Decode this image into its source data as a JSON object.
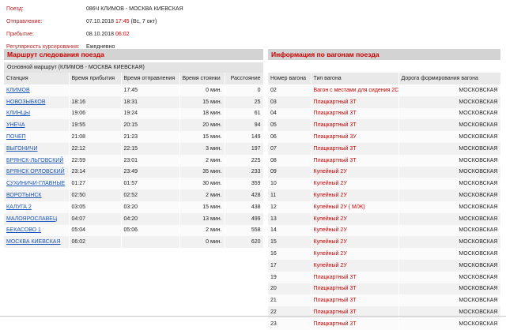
{
  "train": {
    "label": "Поезд:",
    "value": "086Ч КЛИМОВ - МОСКВА КИЕВСКАЯ",
    "dep_label": "Отправление:",
    "dep_date": "07.10.2018",
    "dep_time": "17:45",
    "dep_day": "(Вс, 7 окт)",
    "arr_label": "Прибытие:",
    "arr_date": "08.10.2018",
    "arr_time": "06:02",
    "reg_label": "Регулярность курсирования:",
    "reg_value": "Ежедневно"
  },
  "route": {
    "title": "Маршрут следования поезда",
    "subtitle": "Основной маршрут (КЛИМОВ - МОСКВА КИЕВСКАЯ)",
    "columns": [
      "Станция",
      "Время прибытия",
      "Время отправления",
      "Время стоянки",
      "Расстояние"
    ],
    "rows": [
      {
        "station": "КЛИМОВ",
        "arr": "",
        "dep": "17:45",
        "stop": "0 мин.",
        "dist": "0"
      },
      {
        "station": "НОВОЗЫБКОВ",
        "arr": "18:16",
        "dep": "18:31",
        "stop": "15 мин.",
        "dist": "25"
      },
      {
        "station": "КЛИНЦЫ",
        "arr": "19:06",
        "dep": "19:24",
        "stop": "18 мин.",
        "dist": "61"
      },
      {
        "station": "УНЕЧА",
        "arr": "19:55",
        "dep": "20:15",
        "stop": "20 мин.",
        "dist": "94"
      },
      {
        "station": "ПОЧЕП",
        "arr": "21:08",
        "dep": "21:23",
        "stop": "15 мин.",
        "dist": "149"
      },
      {
        "station": "ВЫГОНИЧИ",
        "arr": "22:12",
        "dep": "22:15",
        "stop": "3 мин.",
        "dist": "197"
      },
      {
        "station": "БРЯНСК-ЛЬГОВСКИЙ",
        "arr": "22:59",
        "dep": "23:01",
        "stop": "2 мин.",
        "dist": "225"
      },
      {
        "station": "БРЯНСК ОРЛОВСКИЙ",
        "arr": "23:14",
        "dep": "23:49",
        "stop": "35 мин.",
        "dist": "233"
      },
      {
        "station": "СУХИНИЧИ-ГЛАВНЫЕ",
        "arr": "01:27",
        "dep": "01:57",
        "stop": "30 мин.",
        "dist": "359"
      },
      {
        "station": "ВОРОТЫНСК",
        "arr": "02:50",
        "dep": "02:52",
        "stop": "2 мин.",
        "dist": "428"
      },
      {
        "station": "КАЛУГА 2",
        "arr": "03:05",
        "dep": "03:20",
        "stop": "15 мин.",
        "dist": "438"
      },
      {
        "station": "МАЛОЯРОСЛАВЕЦ",
        "arr": "04:07",
        "dep": "04:20",
        "stop": "13 мин.",
        "dist": "499"
      },
      {
        "station": "БЕКАСОВО 1",
        "arr": "05:04",
        "dep": "05:06",
        "stop": "2 мин.",
        "dist": "558"
      },
      {
        "station": "МОСКВА КИЕВСКАЯ",
        "arr": "06:02",
        "dep": "",
        "stop": "0 мин.",
        "dist": "620"
      }
    ]
  },
  "cars": {
    "title": "Информация по вагонам поезда",
    "columns": [
      "Номер вагона",
      "Тип вагона",
      "Дорога формирования вагона"
    ],
    "rows": [
      {
        "num": "02",
        "type": "Вагон с местами для сидения 2С",
        "road": "МОСКОВСКАЯ"
      },
      {
        "num": "03",
        "type": "Плацкартный 3Т",
        "road": "МОСКОВСКАЯ"
      },
      {
        "num": "04",
        "type": "Плацкартный 3Т",
        "road": "МОСКОВСКАЯ"
      },
      {
        "num": "05",
        "type": "Плацкартный 3Т",
        "road": "МОСКОВСКАЯ"
      },
      {
        "num": "06",
        "type": "Плацкартный 3У",
        "road": "МОСКОВСКАЯ"
      },
      {
        "num": "07",
        "type": "Плацкартный 3Т",
        "road": "МОСКОВСКАЯ"
      },
      {
        "num": "08",
        "type": "Плацкартный 3Т",
        "road": "МОСКОВСКАЯ"
      },
      {
        "num": "09",
        "type": "Купейный 2У",
        "road": "МОСКОВСКАЯ"
      },
      {
        "num": "10",
        "type": "Купейный 2У",
        "road": "МОСКОВСКАЯ"
      },
      {
        "num": "11",
        "type": "Купейный 2У",
        "road": "МОСКОВСКАЯ"
      },
      {
        "num": "12",
        "type": "Купейный 2У ( М/Ж)",
        "road": "МОСКОВСКАЯ"
      },
      {
        "num": "13",
        "type": "Купейный 2У",
        "road": "МОСКОВСКАЯ"
      },
      {
        "num": "14",
        "type": "Купейный 2У",
        "road": "МОСКОВСКАЯ"
      },
      {
        "num": "15",
        "type": "Купейный 2У",
        "road": "МОСКОВСКАЯ"
      },
      {
        "num": "16",
        "type": "Купейный 2У",
        "road": "МОСКОВСКАЯ"
      },
      {
        "num": "17",
        "type": "Купейный 2У",
        "road": "МОСКОВСКАЯ"
      },
      {
        "num": "19",
        "type": "Плацкартный 3Т",
        "road": "МОСКОВСКАЯ"
      },
      {
        "num": "20",
        "type": "Плацкартный 3Т",
        "road": "МОСКОВСКАЯ"
      },
      {
        "num": "21",
        "type": "Плацкартный 3Т",
        "road": "МОСКОВСКАЯ"
      },
      {
        "num": "22",
        "type": "Плацкартный 3Т",
        "road": "МОСКОВСКАЯ"
      },
      {
        "num": "23",
        "type": "Плацкартный 3Т",
        "road": "МОСКОВСКАЯ"
      }
    ]
  }
}
